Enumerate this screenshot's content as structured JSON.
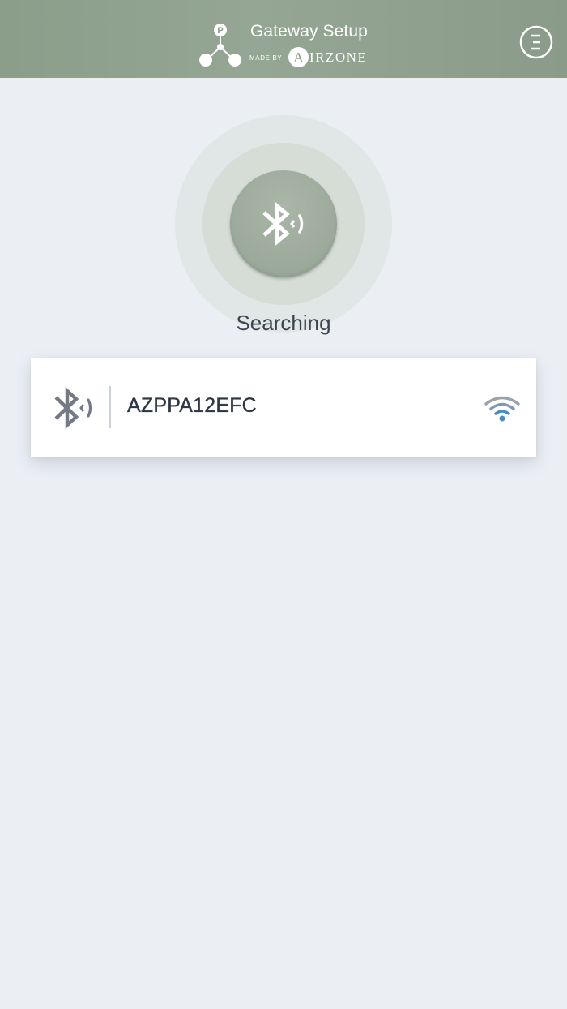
{
  "header": {
    "title": "Gateway Setup",
    "made_by": "MADE BY",
    "brand": "IRZONE",
    "brand_letter": "A",
    "logo_letter": "P",
    "menu_icon": "menu-circle-icon"
  },
  "scan": {
    "status": "Searching",
    "icon": "bluetooth-searching-icon"
  },
  "devices": [
    {
      "name": "AZPPA12EFC",
      "connection_icon": "bluetooth-signal-icon",
      "signal_icon": "wifi-signal-icon"
    }
  ],
  "colors": {
    "header_bg": "#8f a08e",
    "page_bg": "#ebeff4",
    "wifi_accent": "#4a8bc0",
    "icon_gray": "#6f7580"
  }
}
